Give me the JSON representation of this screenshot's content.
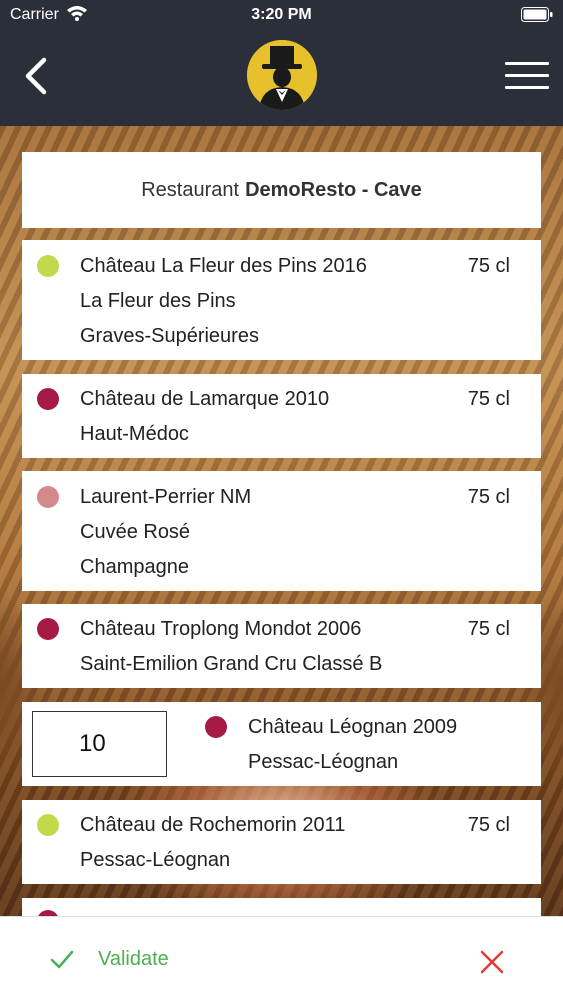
{
  "status_bar": {
    "carrier": "Carrier",
    "time": "3:20 PM"
  },
  "header": {
    "back_icon": "chevron-left-icon",
    "logo_icon": "butler-top-hat-logo",
    "menu_icon": "hamburger-menu-icon"
  },
  "title": {
    "prefix": "Restaurant",
    "name": "DemoResto - Cave"
  },
  "wines": [
    {
      "dot_color": "#c2d94b",
      "lines": [
        "Château La Fleur des Pins 2016",
        "La Fleur des Pins",
        "Graves-Supérieures"
      ],
      "volume": "75 cl"
    },
    {
      "dot_color": "#a51b45",
      "lines": [
        "Château de Lamarque 2010",
        "Haut-Médoc"
      ],
      "volume": "75 cl"
    },
    {
      "dot_color": "#d48a8c",
      "lines": [
        "Laurent-Perrier NM",
        "Cuvée Rosé",
        "Champagne"
      ],
      "volume": "75 cl"
    },
    {
      "dot_color": "#a51b45",
      "lines": [
        "Château Troplong Mondot 2006",
        "Saint-Emilion Grand Cru Classé B"
      ],
      "volume": "75 cl"
    },
    {
      "dot_color": "#a51b45",
      "lines": [
        "Château Léognan 2009",
        "Pessac-Léognan"
      ],
      "quantity": "10"
    },
    {
      "dot_color": "#c2d94b",
      "lines": [
        "Château de Rochemorin 2011",
        "Pessac-Léognan"
      ],
      "volume": "75 cl"
    },
    {
      "dot_color": "#a51b45"
    }
  ],
  "footer": {
    "validate_label": "Validate",
    "validate_color": "#4caf50",
    "cancel_color": "#e53935"
  }
}
